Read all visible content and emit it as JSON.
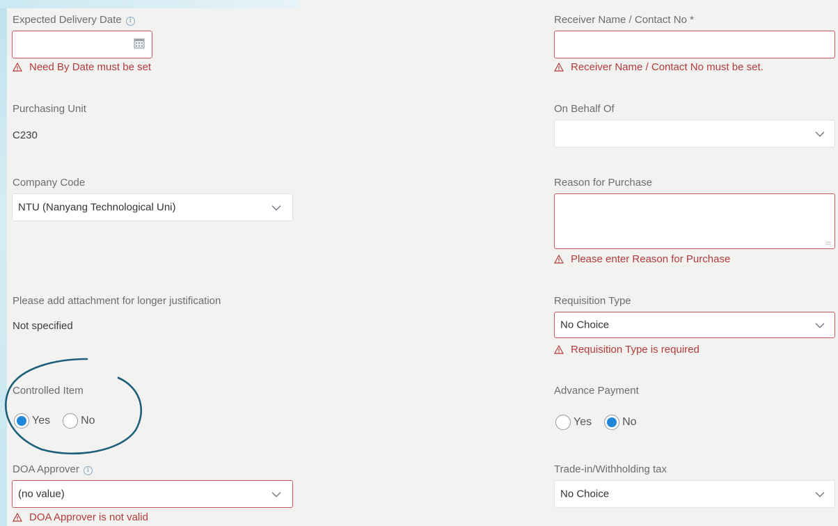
{
  "left": {
    "expected_delivery": {
      "label": "Expected Delivery Date",
      "value": "",
      "error": "Need By Date must be set"
    },
    "purchasing_unit": {
      "label": "Purchasing Unit",
      "value": "C230"
    },
    "company_code": {
      "label": "Company Code",
      "value": "NTU (Nanyang Technological Uni)"
    },
    "attachment": {
      "label": "Please add attachment for longer justification",
      "value": "Not specified"
    },
    "controlled_item": {
      "label": "Controlled Item",
      "options": [
        "Yes",
        "No"
      ],
      "selected": "Yes"
    },
    "doa_approver": {
      "label": "DOA Approver",
      "value": "(no value)",
      "error": "DOA Approver is not valid"
    }
  },
  "right": {
    "receiver": {
      "label": "Receiver Name / Contact No *",
      "value": "",
      "error": "Receiver Name / Contact No must be set."
    },
    "on_behalf_of": {
      "label": "On Behalf Of",
      "value": ""
    },
    "reason": {
      "label": "Reason for Purchase",
      "value": "",
      "error": "Please enter Reason for Purchase"
    },
    "requisition_type": {
      "label": "Requisition Type",
      "value": "No Choice",
      "error": "Requisition Type is required"
    },
    "advance_payment": {
      "label": "Advance Payment",
      "options": [
        "Yes",
        "No"
      ],
      "selected": "No"
    },
    "trade_in": {
      "label": "Trade-in/Withholding tax",
      "value": "No Choice"
    }
  },
  "icons": {
    "info": "info-icon",
    "warning": "warning-icon",
    "calendar": "calendar-icon",
    "chevron": "chevron-down-icon"
  },
  "colors": {
    "error": "#b43a3a",
    "error_border": "#c9595f",
    "radio_selected": "#1f86d9",
    "annotation": "#1d5f7a"
  }
}
